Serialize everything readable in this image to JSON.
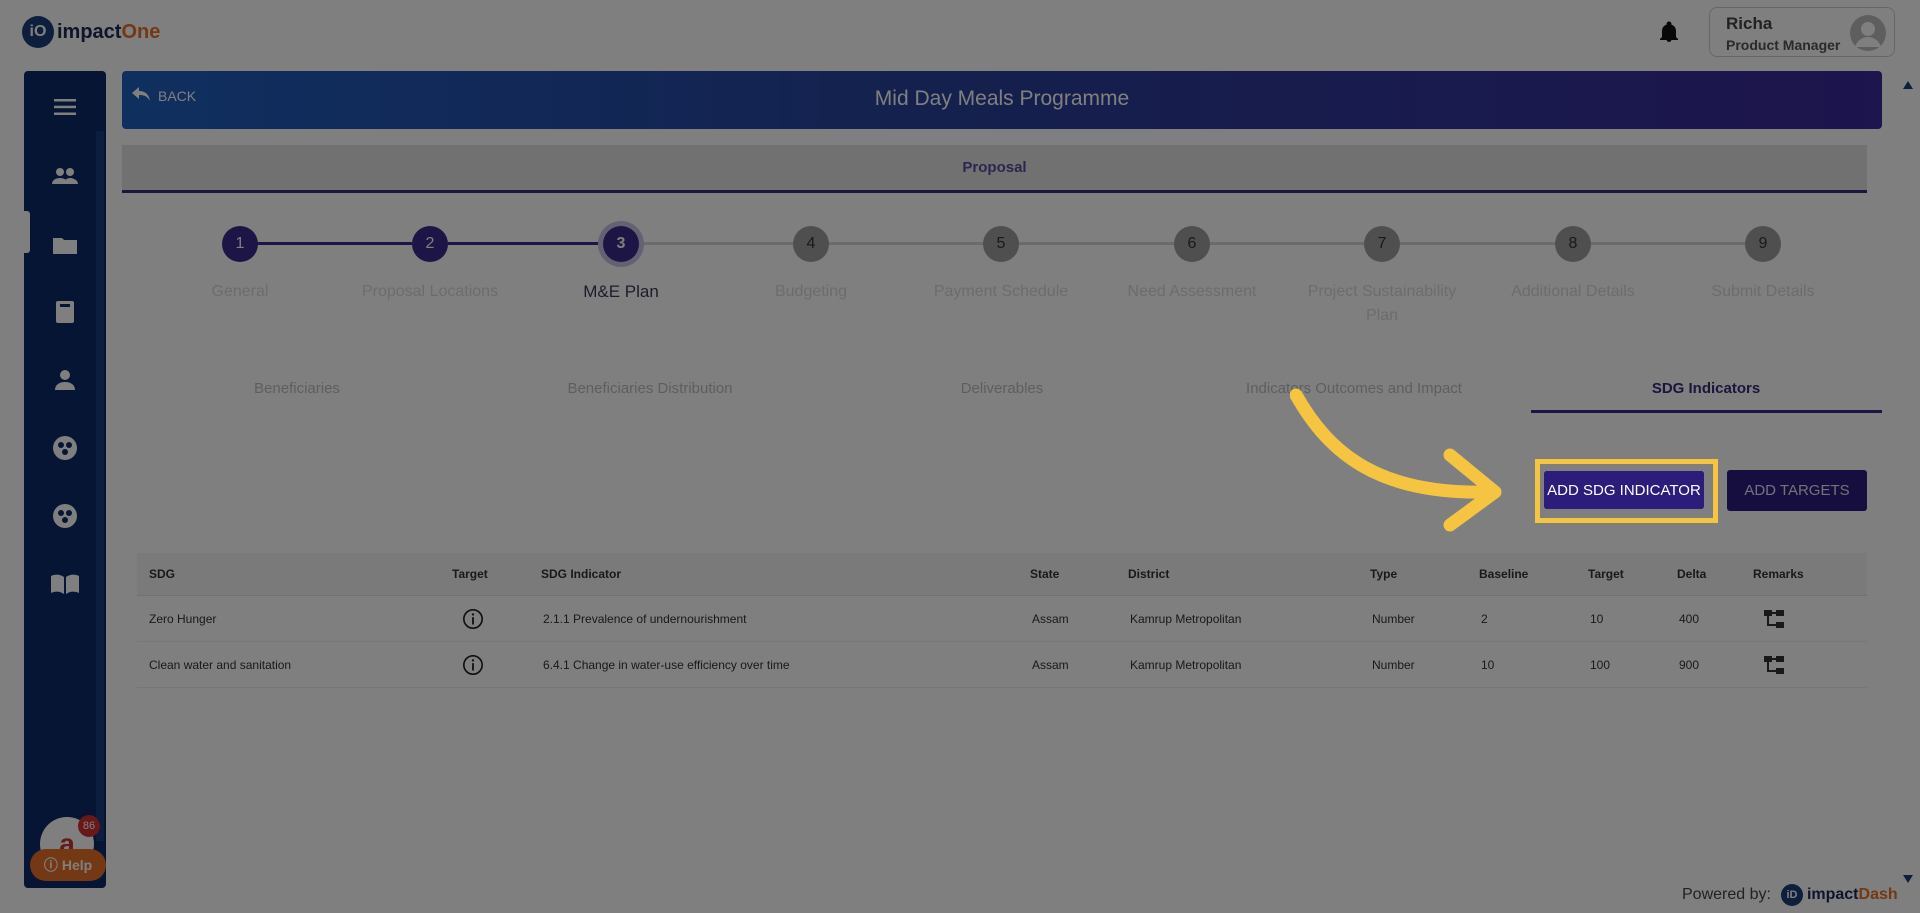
{
  "brand": {
    "logo_letters": "iO",
    "name_a": "impact",
    "name_b": "One"
  },
  "user": {
    "name": "Richa",
    "role": "Product Manager"
  },
  "header": {
    "back_label": "BACK",
    "title": "Mid Day Meals Programme"
  },
  "section": {
    "label": "Proposal"
  },
  "stepper": {
    "current": 3,
    "steps": [
      {
        "num": "1",
        "label": "General"
      },
      {
        "num": "2",
        "label": "Proposal Locations"
      },
      {
        "num": "3",
        "label": "M&E Plan"
      },
      {
        "num": "4",
        "label": "Budgeting"
      },
      {
        "num": "5",
        "label": "Payment Schedule"
      },
      {
        "num": "6",
        "label": "Need Assessment"
      },
      {
        "num": "7",
        "label": "Project Sustainability Plan"
      },
      {
        "num": "8",
        "label": "Additional Details"
      },
      {
        "num": "9",
        "label": "Submit Details"
      }
    ]
  },
  "tabs": {
    "active": "SDG Indicators",
    "items": [
      "Beneficiaries",
      "Beneficiaries Distribution",
      "Deliverables",
      "Indicators Outcomes and Impact",
      "SDG Indicators"
    ]
  },
  "actions": {
    "add_sdg": "ADD SDG INDICATOR",
    "add_targets": "ADD TARGETS"
  },
  "table": {
    "headers": [
      "SDG",
      "Target",
      "SDG Indicator",
      "State",
      "District",
      "Type",
      "Baseline",
      "Target",
      "Delta",
      "Remarks"
    ],
    "rows": [
      {
        "sdg": "Zero Hunger",
        "indicator": "2.1.1 Prevalence of undernourishment",
        "state": "Assam",
        "district": "Kamrup Metropolitan",
        "type": "Number",
        "baseline": "2",
        "target": "10",
        "delta": "400"
      },
      {
        "sdg": "Clean water and sanitation",
        "indicator": "6.4.1 Change in water-use efficiency over time",
        "state": "Assam",
        "district": "Kamrup Metropolitan",
        "type": "Number",
        "baseline": "10",
        "target": "100",
        "delta": "900"
      }
    ]
  },
  "chat": {
    "letter": "a",
    "badge": "86"
  },
  "help": {
    "label": "Help"
  },
  "footer": {
    "powered_by": "Powered by:",
    "logo_letters": "iD",
    "name_a": "impact",
    "name_b": "Dash"
  },
  "colors": {
    "primary": "#2c1c7c",
    "accent": "#e8702a",
    "highlight": "#f5c542",
    "sidebar": "#0a2a66"
  }
}
